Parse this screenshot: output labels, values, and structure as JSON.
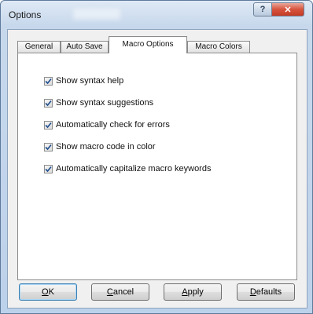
{
  "window": {
    "title": "Options",
    "help_glyph": "?",
    "close_glyph": "✕"
  },
  "tabs": [
    {
      "label": "General",
      "active": false
    },
    {
      "label": "Auto Save",
      "active": false
    },
    {
      "label": "Macro Options",
      "active": true
    },
    {
      "label": "Macro Colors",
      "active": false
    }
  ],
  "options": [
    {
      "label": "Show syntax help",
      "checked": true
    },
    {
      "label": "Show syntax suggestions",
      "checked": true
    },
    {
      "label": "Automatically check for errors",
      "checked": true
    },
    {
      "label": "Show macro code in color",
      "checked": true
    },
    {
      "label": "Automatically capitalize macro keywords",
      "checked": true
    }
  ],
  "buttons": {
    "ok": {
      "mnemonic": "O",
      "rest": "K"
    },
    "cancel": {
      "mnemonic": "C",
      "rest": "ancel"
    },
    "apply": {
      "mnemonic": "A",
      "rest": "pply"
    },
    "defaults": {
      "mnemonic": "D",
      "rest": "efaults"
    }
  },
  "icons": {
    "checkbox_check": "checkmark-icon",
    "help": "help-icon",
    "close": "close-icon"
  },
  "colors": {
    "check": "#1f4e8c",
    "close_button": "#d7533d",
    "default_button_border": "#3c7fb1"
  }
}
